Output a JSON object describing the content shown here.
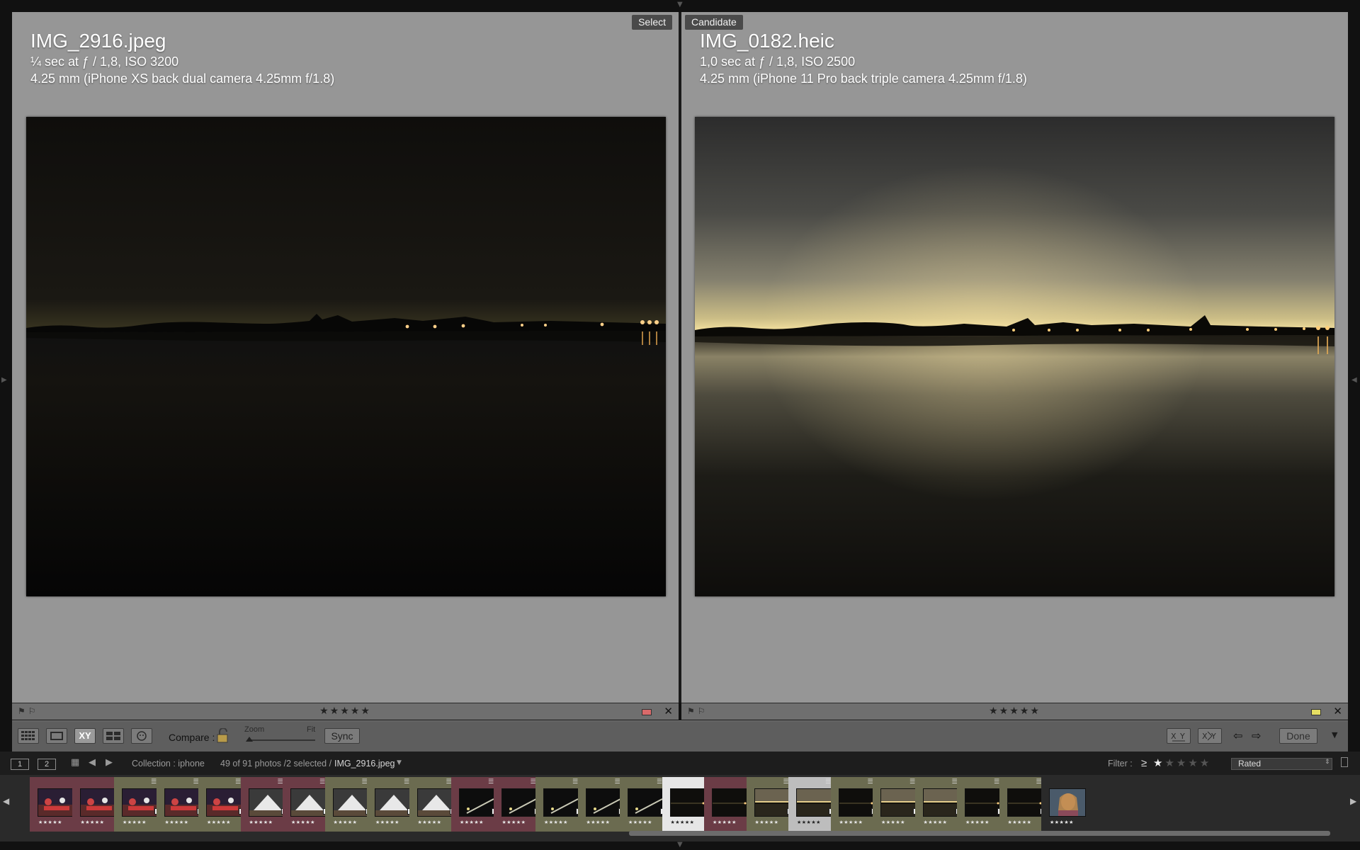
{
  "left_pane": {
    "tag": "Select",
    "filename": "IMG_2916.jpeg",
    "exposure": "¼ sec at ƒ / 1,8, ISO 3200",
    "lens": "4.25 mm (iPhone XS back dual camera 4.25mm f/1.8)",
    "stars": "★★★★★",
    "label_color": "#d96a6a"
  },
  "right_pane": {
    "tag": "Candidate",
    "filename": "IMG_0182.heic",
    "exposure": "1,0 sec at ƒ / 1,8, ISO 2500",
    "lens": "4.25 mm (iPhone 11 Pro back triple camera 4.25mm f/1.8)",
    "stars": "★★★★★",
    "label_color": "#e6df63"
  },
  "toolbar": {
    "compare_label": "Compare :",
    "zoom_label": "Zoom",
    "fit_label": "Fit",
    "sync_label": "Sync",
    "done_label": "Done",
    "xy_label": "XY"
  },
  "filmstrip_header": {
    "page1": "1",
    "page2": "2",
    "collection": "Collection : iphone",
    "count": "49 of 91 photos /2 selected /",
    "current_file": "IMG_2916.jpeg",
    "filter_label": "Filter :",
    "filter_op": "≥",
    "filter_value": "Rated"
  },
  "filmstrip": {
    "thumbnails": [
      {
        "scene": "party",
        "tint": "#6b3c46"
      },
      {
        "scene": "party",
        "tint": "#6b3c46"
      },
      {
        "scene": "party",
        "tint": "#6b6b50"
      },
      {
        "scene": "party",
        "tint": "#6b6b50"
      },
      {
        "scene": "party",
        "tint": "#6b6b50"
      },
      {
        "scene": "tent",
        "tint": "#6b3c46"
      },
      {
        "scene": "tent",
        "tint": "#6b3c46"
      },
      {
        "scene": "tent",
        "tint": "#6b6b50"
      },
      {
        "scene": "tent",
        "tint": "#6b6b50"
      },
      {
        "scene": "tent",
        "tint": "#6b6b50"
      },
      {
        "scene": "night",
        "tint": "#6b3c46"
      },
      {
        "scene": "night",
        "tint": "#6b3c46"
      },
      {
        "scene": "night",
        "tint": "#6b6b50"
      },
      {
        "scene": "night",
        "tint": "#6b6b50"
      },
      {
        "scene": "night",
        "tint": "#6b6b50"
      },
      {
        "scene": "lake-dark",
        "tint": "#e6e6e6"
      },
      {
        "scene": "lake-dark",
        "tint": "#6b3c46"
      },
      {
        "scene": "lake-gold",
        "tint": "#6b6b50"
      },
      {
        "scene": "lake-gold",
        "tint": "#bdbdbd"
      },
      {
        "scene": "lake-dark",
        "tint": "#6b6b50"
      },
      {
        "scene": "lake-gold",
        "tint": "#6b6b50"
      },
      {
        "scene": "lake-gold",
        "tint": "#6b6b50"
      },
      {
        "scene": "lake-dark",
        "tint": "#6b6b50"
      },
      {
        "scene": "lake-dark",
        "tint": "#6b6b50"
      },
      {
        "scene": "portrait",
        "tint": "#2a2a2a"
      }
    ],
    "thumb_stars": "★★★★★"
  }
}
